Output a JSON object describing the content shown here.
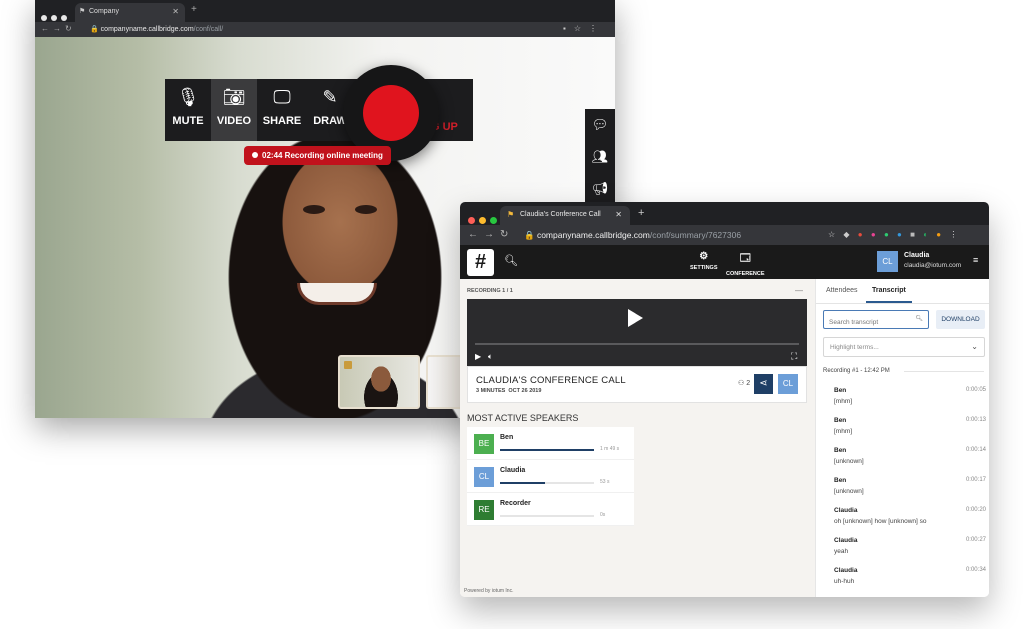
{
  "back_window": {
    "tab_title": "Company",
    "url_host": "companyname.callbridge.com",
    "url_path": "/conf/call/",
    "toolbar": [
      {
        "label": "MUTE",
        "icon": "microphone-icon"
      },
      {
        "label": "VIDEO",
        "icon": "camera-icon"
      },
      {
        "label": "SHARE",
        "icon": "monitor-icon"
      },
      {
        "label": "DRAW",
        "icon": "pencil-icon"
      }
    ],
    "hangup_label": "G UP",
    "recording_banner": "02:44 Recording online meeting"
  },
  "front_window": {
    "tab_title": "Claudia's Conference Call",
    "url_host": "companyname.callbridge.com",
    "url_path": "/conf/summary/7627306",
    "nav": {
      "settings": "SETTINGS",
      "conference": "CONFERENCE"
    },
    "user": {
      "initials": "CL",
      "name": "Claudia",
      "email": "claudia@iotum.com"
    },
    "recording_header": "RECORDING 1 / 1",
    "conference": {
      "title": "CLAUDIA'S CONFERENCE CALL",
      "duration": "3 MINUTES",
      "date": "OCT 26 2019",
      "participants": "2",
      "avatar": "CL"
    },
    "speakers_title": "MOST ACTIVE SPEAKERS",
    "speakers": [
      {
        "initials": "BE",
        "name": "Ben",
        "duration": "1 m 49 s",
        "share": 1.0,
        "color": "#4caf50"
      },
      {
        "initials": "CL",
        "name": "Claudia",
        "duration": "53 s",
        "share": 0.48,
        "color": "#6c9ed8"
      },
      {
        "initials": "RE",
        "name": "Recorder",
        "duration": "0s",
        "share": 0,
        "color": "#2e7d32"
      }
    ],
    "powered_by": "Powered by iotum Inc.",
    "panel": {
      "tabs": [
        "Attendees",
        "Transcript"
      ],
      "active_tab": "Transcript",
      "search_placeholder": "Search transcript",
      "download_label": "DOWNLOAD",
      "highlight_placeholder": "Highlight terms...",
      "recording_label": "Recording #1 - 12:42 PM",
      "entries": [
        {
          "speaker": "Ben",
          "time": "0:00:05",
          "text": "[mhm]"
        },
        {
          "speaker": "Ben",
          "time": "0:00:13",
          "text": "[mhm]"
        },
        {
          "speaker": "Ben",
          "time": "0:00:14",
          "text": "[unknown]"
        },
        {
          "speaker": "Ben",
          "time": "0:00:17",
          "text": "[unknown]"
        },
        {
          "speaker": "Claudia",
          "time": "0:00:20",
          "text": "oh [unknown] how [unknown] so"
        },
        {
          "speaker": "Claudia",
          "time": "0:00:27",
          "text": "yeah"
        },
        {
          "speaker": "Claudia",
          "time": "0:00:34",
          "text": "uh-huh"
        }
      ]
    }
  },
  "colors": {
    "record_red": "#e0141e",
    "banner_red": "#c1121c",
    "navy": "#1f3f66",
    "accent_blue": "#6c9ed8"
  }
}
